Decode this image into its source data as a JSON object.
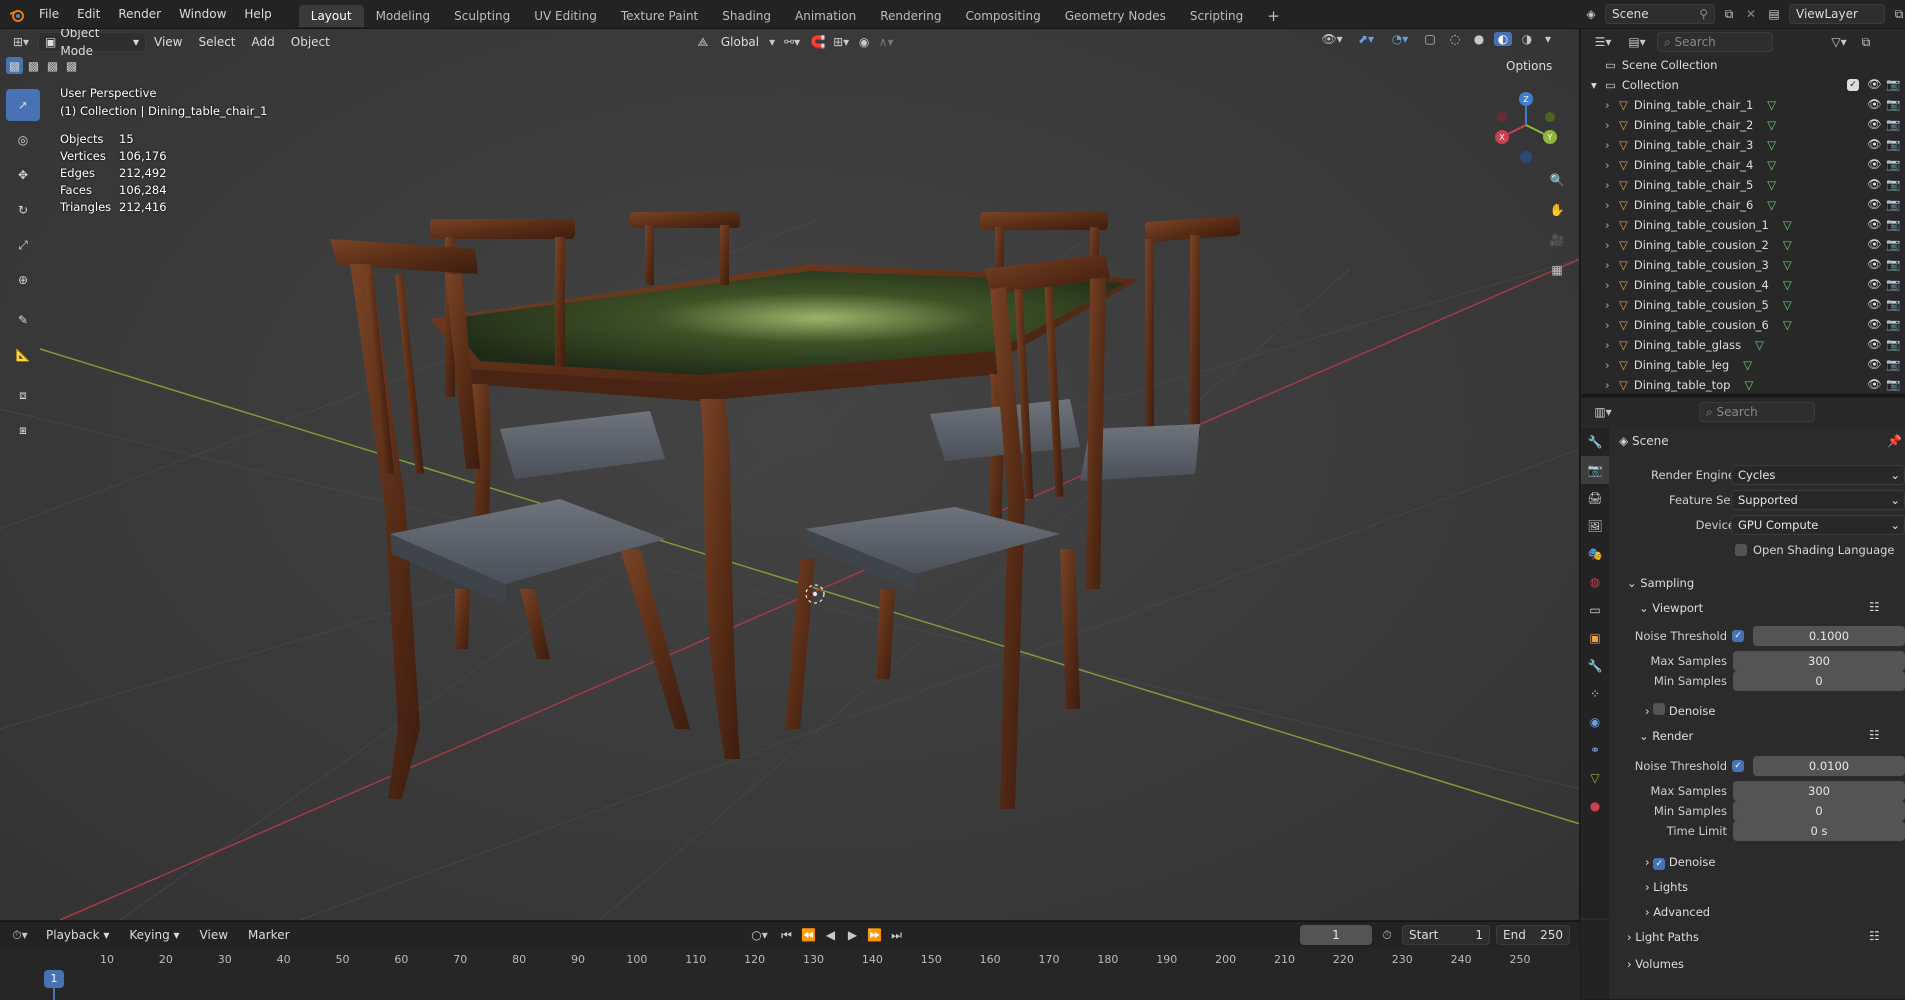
{
  "topbar": {
    "menus": [
      "File",
      "Edit",
      "Render",
      "Window",
      "Help"
    ],
    "workspaces": [
      "Layout",
      "Modeling",
      "Sculpting",
      "UV Editing",
      "Texture Paint",
      "Shading",
      "Animation",
      "Rendering",
      "Compositing",
      "Geometry Nodes",
      "Scripting"
    ],
    "active_workspace": "Layout",
    "scene": "Scene",
    "view_layer": "ViewLayer"
  },
  "viewport_header": {
    "mode": "Object Mode",
    "menus": [
      "View",
      "Select",
      "Add",
      "Object"
    ],
    "orientation": "Global",
    "options": "Options"
  },
  "overlay": {
    "view_name": "User Perspective",
    "context": "(1) Collection | Dining_table_chair_1",
    "stats": [
      {
        "label": "Objects",
        "value": "15"
      },
      {
        "label": "Vertices",
        "value": "106,176"
      },
      {
        "label": "Edges",
        "value": "212,492"
      },
      {
        "label": "Faces",
        "value": "106,284"
      },
      {
        "label": "Triangles",
        "value": "212,416"
      }
    ]
  },
  "gizmo": {
    "x": "X",
    "y": "Y",
    "z": "Z"
  },
  "outliner": {
    "search_placeholder": "Search",
    "root": "Scene Collection",
    "collection": "Collection",
    "objects": [
      "Dining_table_chair_1",
      "Dining_table_chair_2",
      "Dining_table_chair_3",
      "Dining_table_chair_4",
      "Dining_table_chair_5",
      "Dining_table_chair_6",
      "Dining_table_cousion_1",
      "Dining_table_cousion_2",
      "Dining_table_cousion_3",
      "Dining_table_cousion_4",
      "Dining_table_cousion_5",
      "Dining_table_cousion_6",
      "Dining_table_glass",
      "Dining_table_leg",
      "Dining_table_top"
    ]
  },
  "properties": {
    "search_placeholder": "Search",
    "context": "Scene",
    "render_engine_label": "Render Engine",
    "render_engine": "Cycles",
    "feature_set_label": "Feature Set",
    "feature_set": "Supported",
    "device_label": "Device",
    "device": "GPU Compute",
    "osl_label": "Open Shading Language",
    "sampling": "Sampling",
    "viewport": "Viewport",
    "noise_threshold_label": "Noise Threshold",
    "viewport_noise": "0.1000",
    "max_samples_label": "Max Samples",
    "viewport_max": "300",
    "min_samples_label": "Min Samples",
    "viewport_min": "0",
    "denoise_label": "Denoise",
    "render": "Render",
    "render_noise": "0.0100",
    "render_max": "300",
    "render_min": "0",
    "time_limit_label": "Time Limit",
    "time_limit": "0 s",
    "lights": "Lights",
    "advanced": "Advanced",
    "light_paths": "Light Paths",
    "volumes": "Volumes"
  },
  "timeline": {
    "menus": [
      "Playback",
      "Keying",
      "View",
      "Marker"
    ],
    "current_frame": "1",
    "start_label": "Start",
    "start": "1",
    "end_label": "End",
    "end": "250",
    "ticks": [
      "1",
      "10",
      "20",
      "30",
      "40",
      "50",
      "60",
      "70",
      "80",
      "90",
      "100",
      "110",
      "120",
      "130",
      "140",
      "150",
      "160",
      "170",
      "180",
      "190",
      "200",
      "210",
      "220",
      "230",
      "240",
      "250"
    ]
  },
  "colors": {
    "accent": "#4772b3",
    "x_axis": "#c84150",
    "y_axis": "#8cb63c",
    "z_axis": "#3e7ed1"
  }
}
